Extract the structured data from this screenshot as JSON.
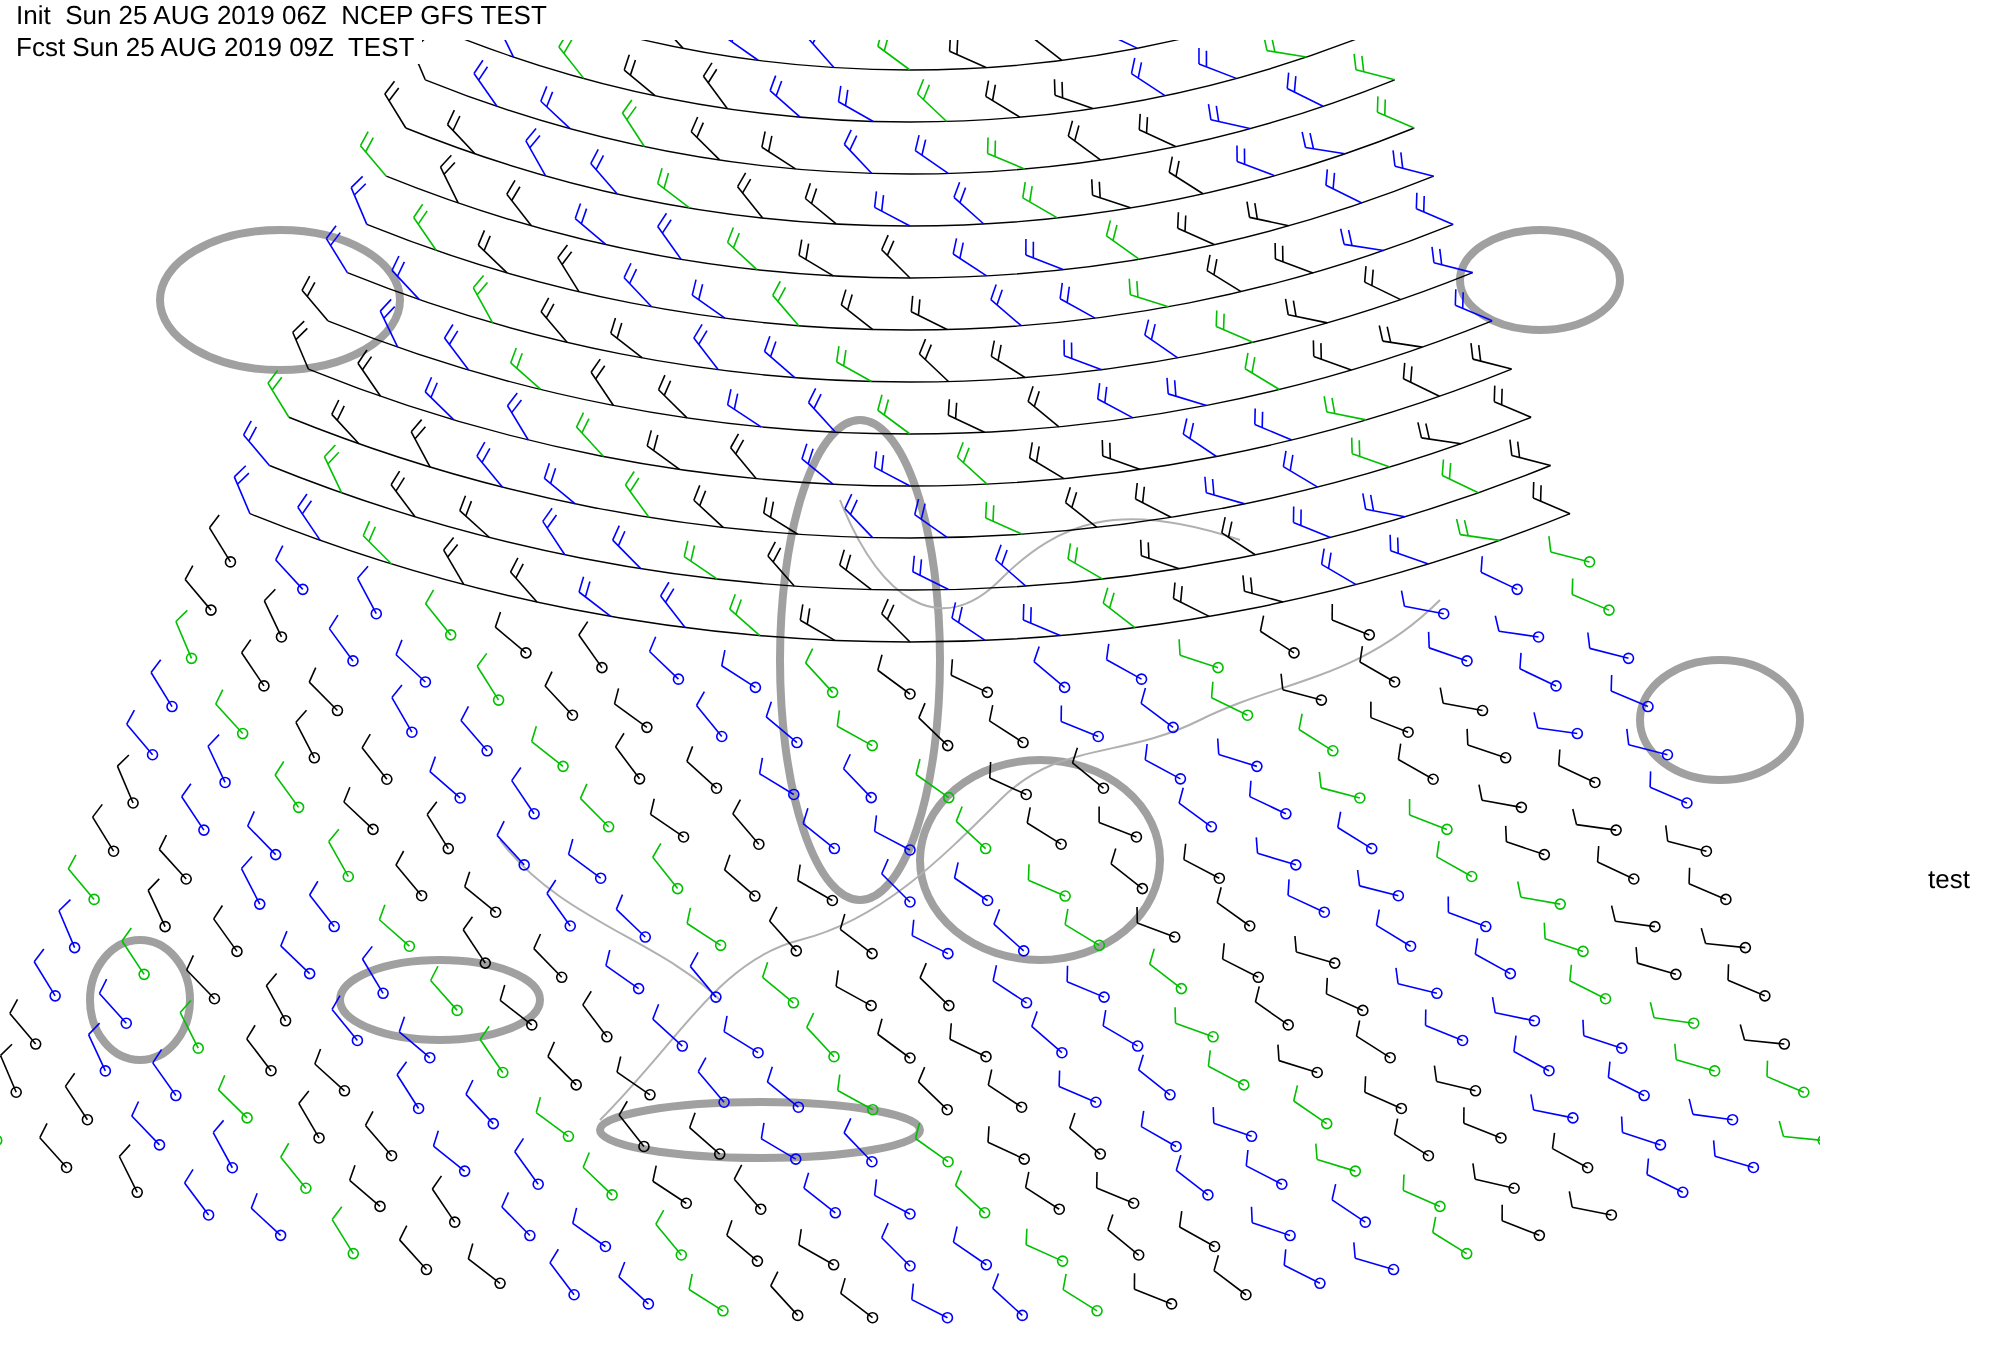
{
  "header": {
    "init_line": "Init  Sun 25 AUG 2019 06Z  NCEP GFS TEST",
    "forecast_line": "Fcst Sun 25 AUG 2019 09Z  TEST"
  },
  "side_label": "test"
}
